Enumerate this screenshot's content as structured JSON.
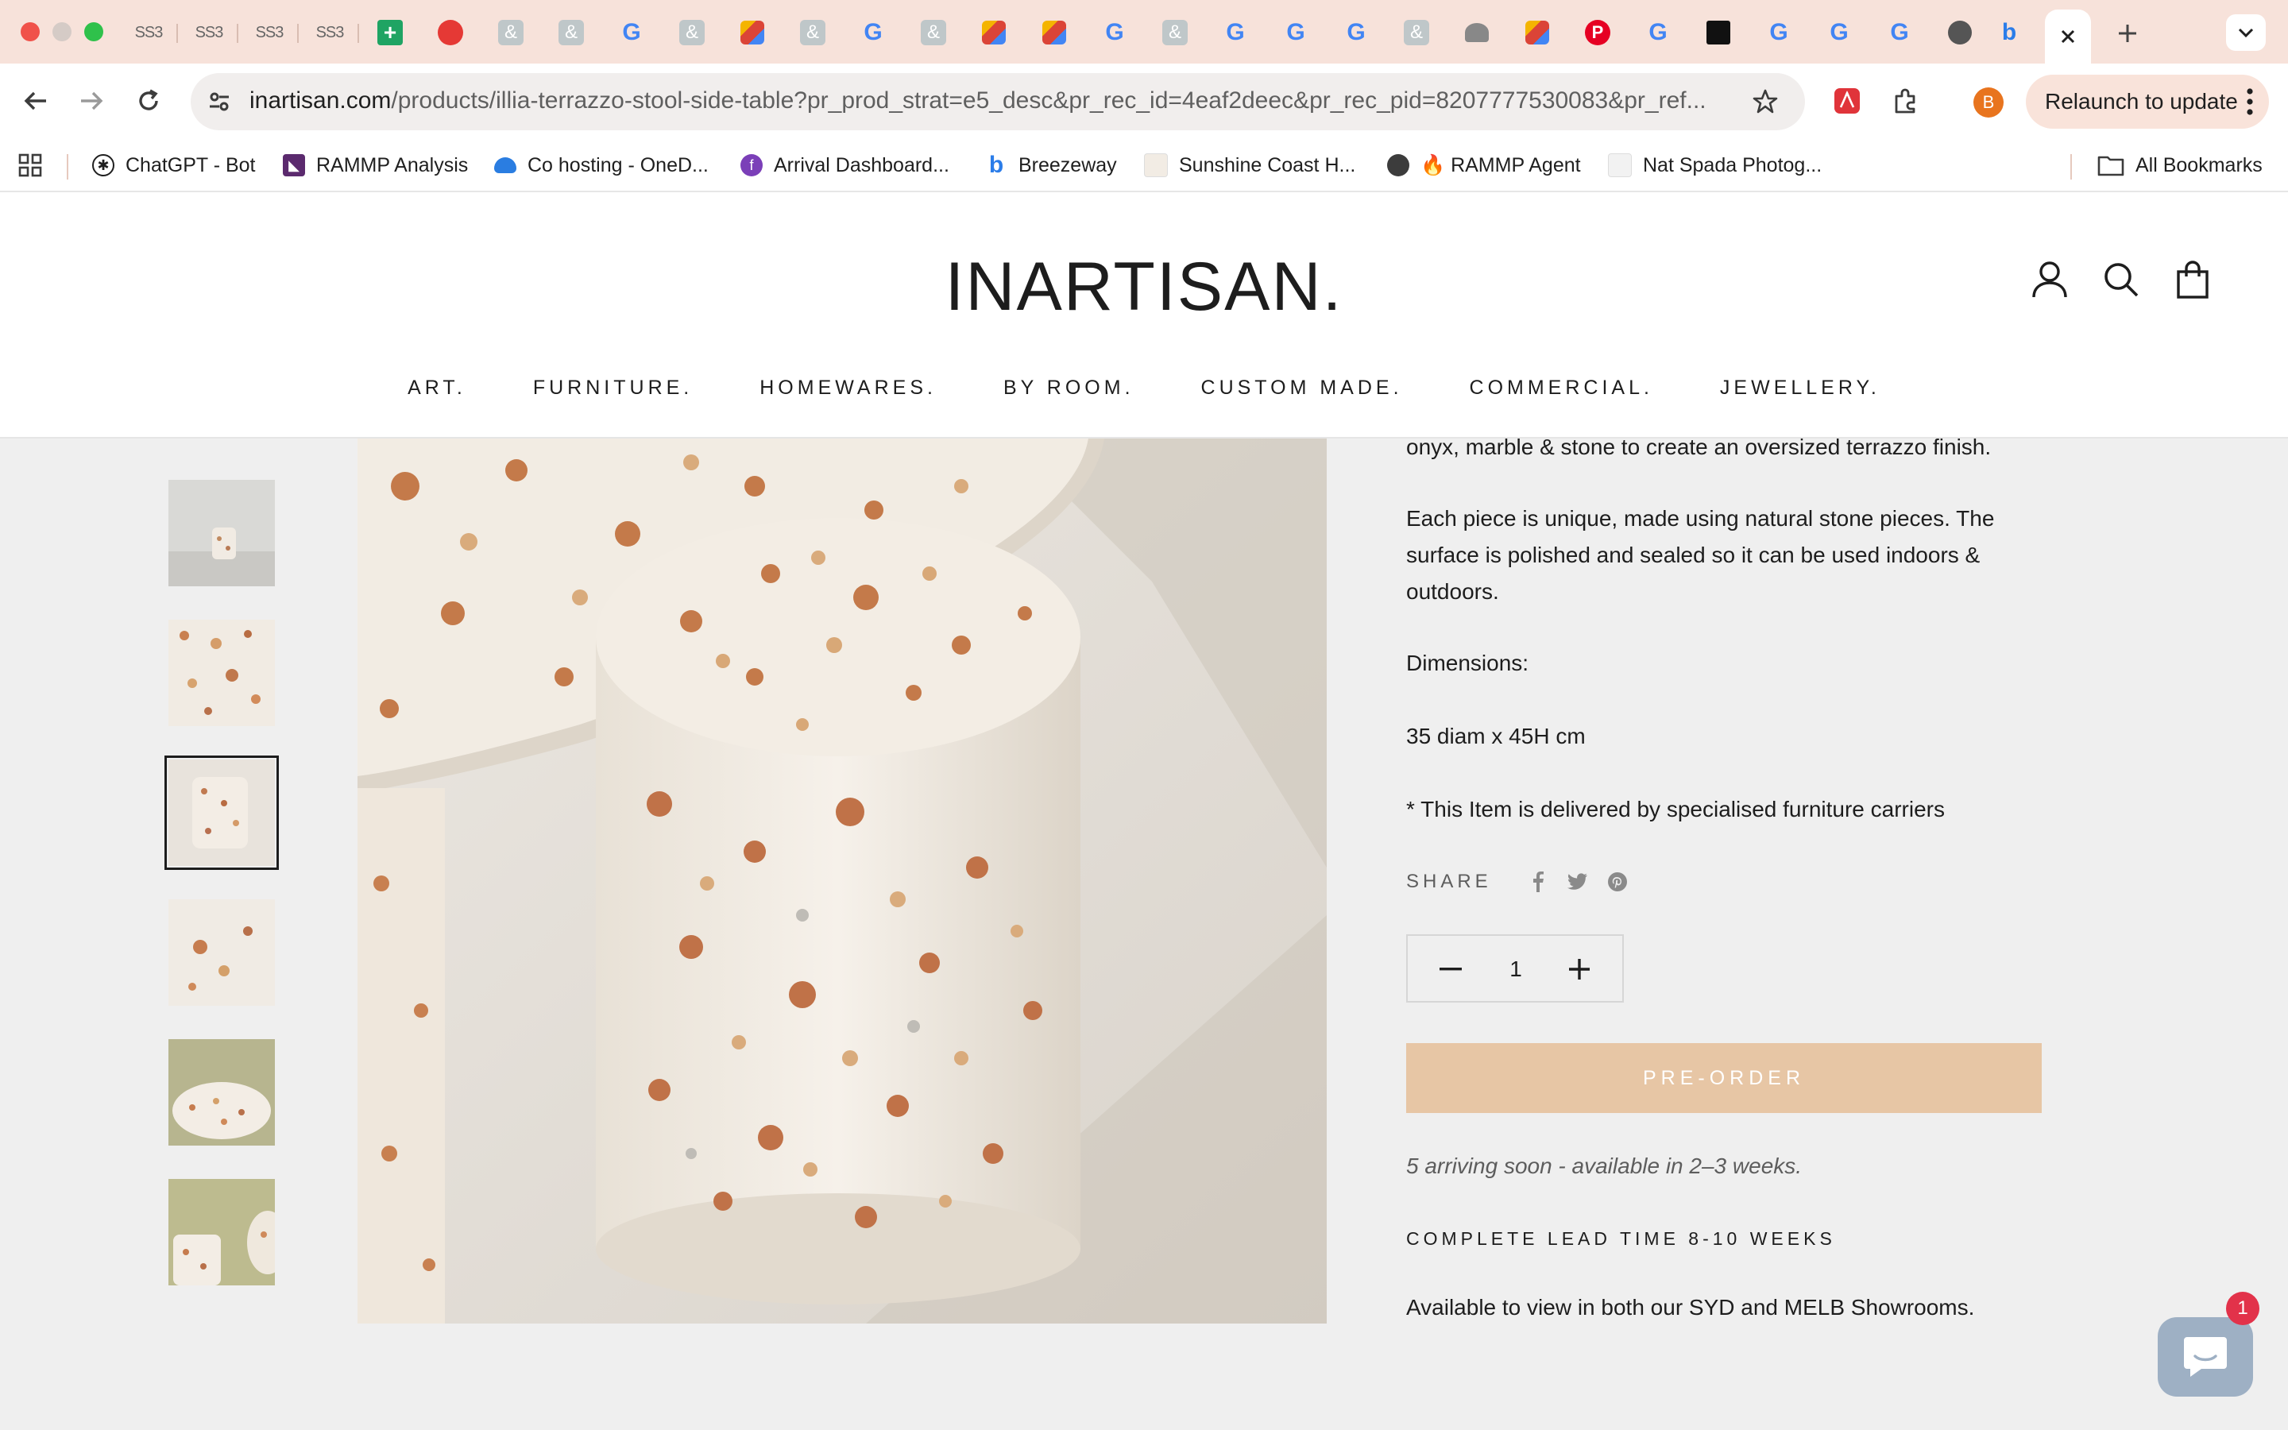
{
  "browser": {
    "url_domain": "inartisan.com",
    "url_path": "/products/illia-terrazzo-stool-side-table?pr_prod_strat=e5_desc&pr_rec_id=4eaf2deec&pr_rec_pid=8207777530083&pr_ref...",
    "relaunch_label": "Relaunch to update",
    "profile_initial": "B",
    "tab_ss_label": "SS3",
    "bookmarks": [
      {
        "label": "ChatGPT - Bot",
        "icon": "chatgpt-icon"
      },
      {
        "label": "RAMMP Analysis",
        "icon": "rammp-icon"
      },
      {
        "label": "Co hosting - OneD...",
        "icon": "onedrive-icon"
      },
      {
        "label": "Arrival Dashboard...",
        "icon": "arrival-icon"
      },
      {
        "label": "Breezeway",
        "icon": "breezeway-icon"
      },
      {
        "label": "Sunshine Coast H...",
        "icon": "page-icon"
      },
      {
        "label": "🔥 RAMMP Agent",
        "icon": "globe-icon"
      },
      {
        "label": "Nat Spada Photog...",
        "icon": "page-icon"
      }
    ],
    "all_bookmarks_label": "All Bookmarks"
  },
  "site": {
    "logo": "INARTISAN.",
    "nav": [
      "ART.",
      "FURNITURE.",
      "HOMEWARES.",
      "BY ROOM.",
      "CUSTOM MADE.",
      "COMMERCIAL.",
      "JEWELLERY."
    ]
  },
  "product": {
    "desc_1": "onyx, marble & stone to create an oversized terrazzo finish.",
    "desc_2": "Each piece is unique, made using natural stone pieces.  The surface is polished and sealed so it can be used indoors & outdoors.",
    "dimensions_label": "Dimensions:",
    "dimensions_value": "35 diam x 45H cm",
    "delivery_note": "* This Item is delivered by specialised furniture carriers",
    "share_label": "SHARE",
    "quantity": "1",
    "preorder_label": "PRE-ORDER",
    "availability": "5 arriving soon - available in 2–3 weeks.",
    "lead_time": "COMPLETE LEAD TIME 8-10 WEEKS",
    "showroom": "Available to view in both our SYD and MELB Showrooms."
  },
  "chat": {
    "badge_count": "1"
  },
  "colors": {
    "accent": "#e7c6a5",
    "tabstrip": "#f7e2da",
    "badge": "#e2324a"
  }
}
